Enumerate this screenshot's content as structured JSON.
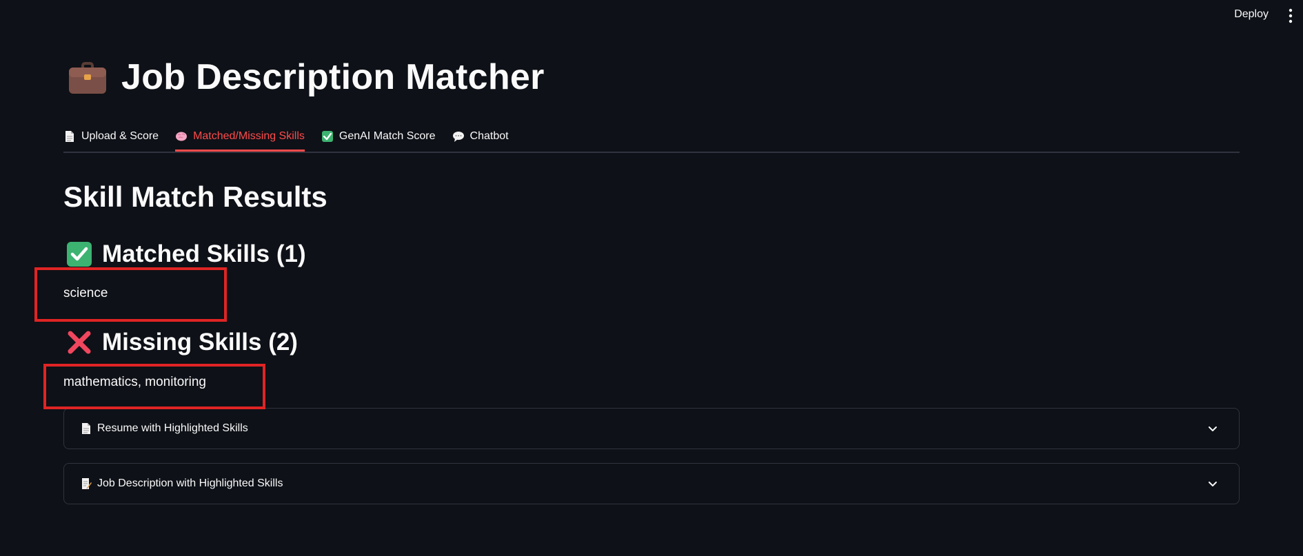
{
  "header": {
    "deploy_label": "Deploy",
    "menu_icon": "more-vertical-icon"
  },
  "app": {
    "title": "Job Description Matcher",
    "title_icon": "briefcase-icon"
  },
  "tabs": [
    {
      "label": "Upload & Score",
      "icon": "page-icon",
      "active": false
    },
    {
      "label": "Matched/Missing Skills",
      "icon": "brain-icon",
      "active": true
    },
    {
      "label": "GenAI Match Score",
      "icon": "check-box-icon",
      "active": false
    },
    {
      "label": "Chatbot",
      "icon": "speech-bubble-icon",
      "active": false
    }
  ],
  "results": {
    "heading": "Skill Match Results",
    "matched": {
      "heading": "Matched Skills (1)",
      "icon": "green-check-icon",
      "text": "science"
    },
    "missing": {
      "heading": "Missing Skills (2)",
      "icon": "red-cross-icon",
      "text": "mathematics, monitoring"
    }
  },
  "expanders": [
    {
      "label": "Resume with Highlighted Skills",
      "icon": "page-icon"
    },
    {
      "label": "Job Description with Highlighted Skills",
      "icon": "memo-icon"
    }
  ],
  "colors": {
    "background": "#0e1117",
    "accent": "#ff4b4b",
    "highlight_box": "#e02424",
    "check_green": "#3cb371"
  }
}
